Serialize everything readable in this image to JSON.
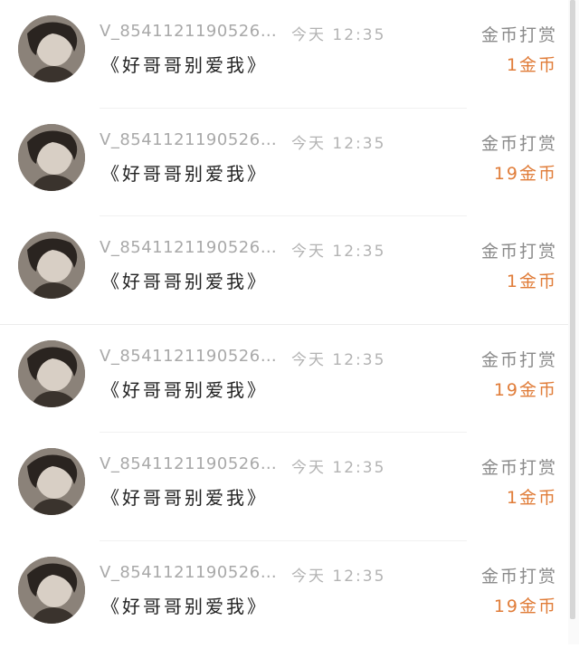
{
  "rows": [
    {
      "username": "V_8541121190526…",
      "time": "今天 12:35",
      "book": "《好哥哥别爱我》",
      "label": "金币打赏",
      "amount": "1金币"
    },
    {
      "username": "V_8541121190526…",
      "time": "今天 12:35",
      "book": "《好哥哥别爱我》",
      "label": "金币打赏",
      "amount": "19金币"
    },
    {
      "username": "V_8541121190526…",
      "time": "今天 12:35",
      "book": "《好哥哥别爱我》",
      "label": "金币打赏",
      "amount": "1金币"
    },
    {
      "username": "V_8541121190526…",
      "time": "今天 12:35",
      "book": "《好哥哥别爱我》",
      "label": "金币打赏",
      "amount": "19金币"
    },
    {
      "username": "V_8541121190526…",
      "time": "今天 12:35",
      "book": "《好哥哥别爱我》",
      "label": "金币打赏",
      "amount": "1金币"
    },
    {
      "username": "V_8541121190526…",
      "time": "今天 12:35",
      "book": "《好哥哥别爱我》",
      "label": "金币打赏",
      "amount": "19金币"
    }
  ],
  "colors": {
    "accent": "#e07c38",
    "label": "#8a8a8a",
    "muted": "#a9a9a9"
  }
}
